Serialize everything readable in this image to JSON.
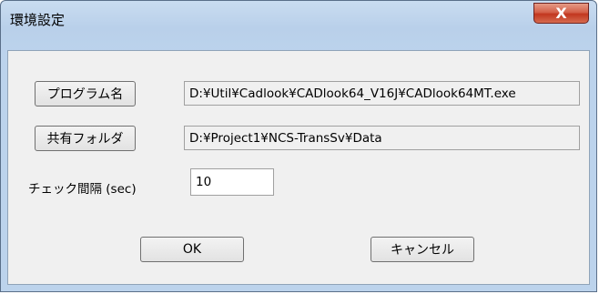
{
  "window": {
    "title": "環境設定",
    "close_glyph": "X"
  },
  "form": {
    "program_button": "プログラム名",
    "program_path": "D:¥Util¥Cadlook¥CADlook64_V16J¥CADlook64MT.exe",
    "shared_folder_button": "共有フォルダ",
    "shared_folder_path": "D:¥Project1¥NCS-TransSv¥Data",
    "interval_label": "チェック間隔 (sec)",
    "interval_value": "10"
  },
  "buttons": {
    "ok": "OK",
    "cancel": "キャンセル"
  }
}
